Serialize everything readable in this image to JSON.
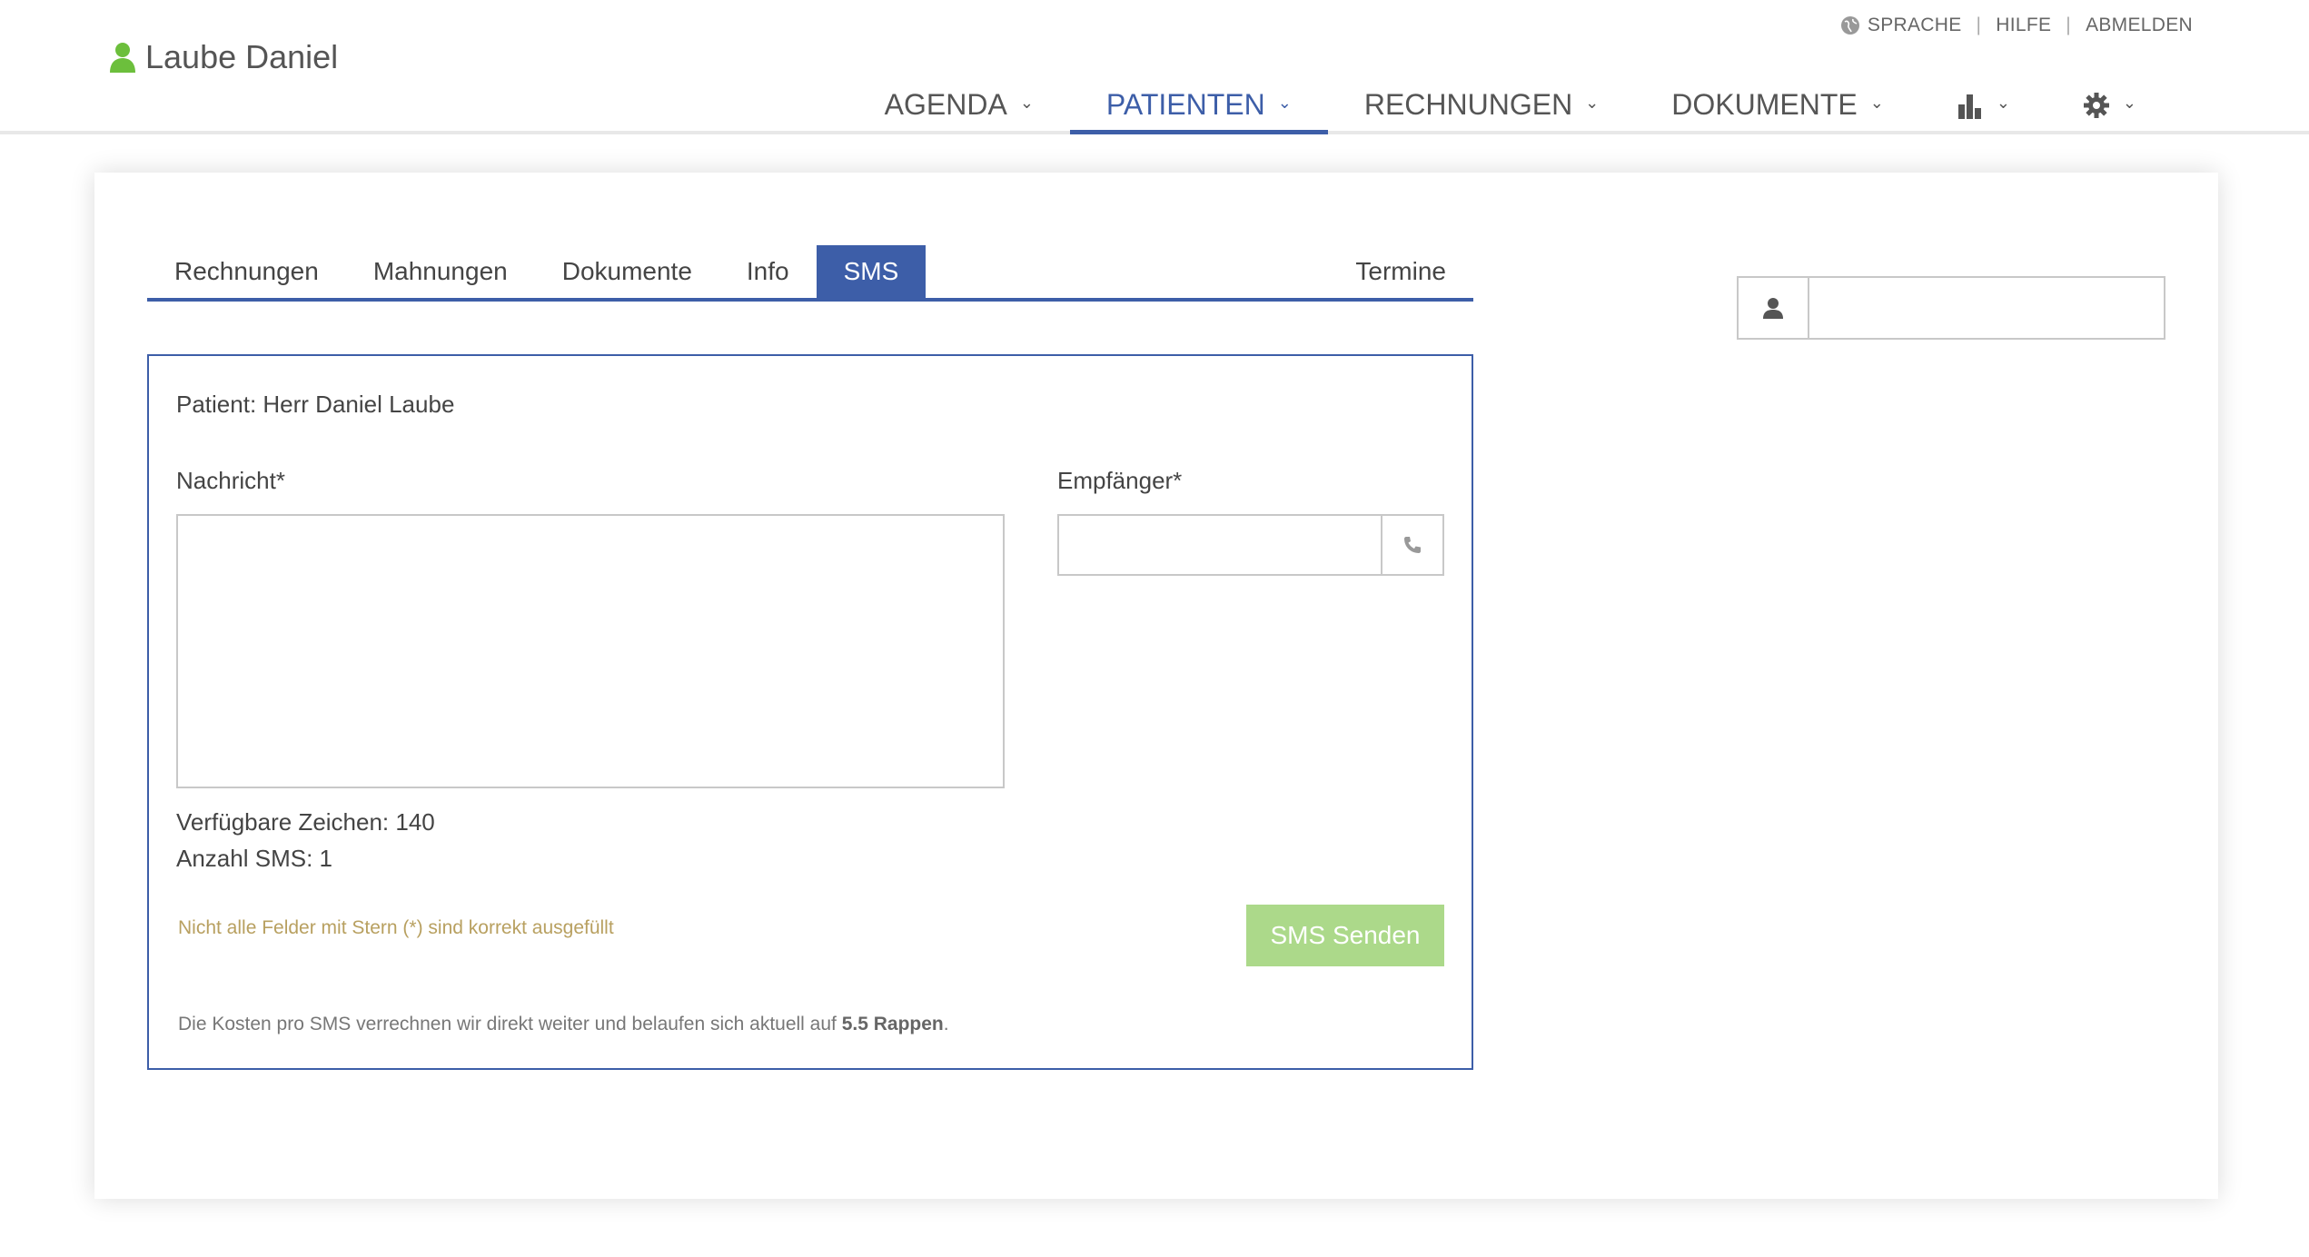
{
  "header": {
    "user_name": "Laube Daniel",
    "top_links": {
      "language": "SPRACHE",
      "help": "HILFE",
      "logout": "ABMELDEN"
    },
    "nav": [
      {
        "label": "AGENDA",
        "active": false
      },
      {
        "label": "PATIENTEN",
        "active": true
      },
      {
        "label": "RECHNUNGEN",
        "active": false
      },
      {
        "label": "DOKUMENTE",
        "active": false
      }
    ],
    "nav_icons": [
      "bar-chart-icon",
      "gear-icon"
    ],
    "chevron": "⌄"
  },
  "tabs": [
    {
      "label": "Rechnungen",
      "active": false
    },
    {
      "label": "Mahnungen",
      "active": false
    },
    {
      "label": "Dokumente",
      "active": false
    },
    {
      "label": "Info",
      "active": false
    },
    {
      "label": "SMS",
      "active": true
    },
    {
      "label": "Termine",
      "active": false
    }
  ],
  "sms_form": {
    "patient_line": "Patient: Herr Daniel Laube",
    "message_label": "Nachricht*",
    "message_value": "",
    "recipient_label": "Empfänger*",
    "recipient_value": "",
    "available_chars": "Verfügbare Zeichen: 140",
    "sms_count": "Anzahl SMS: 1",
    "warning": "Nicht alle Felder mit Stern (*) sind korrekt ausgefüllt",
    "send_label": "SMS Senden",
    "footnote_prefix": "Die Kosten pro SMS verrechnen wir direkt weiter und belaufen sich aktuell auf ",
    "footnote_amount": "5.5 Rappen",
    "footnote_suffix": "."
  },
  "search": {
    "value": ""
  },
  "colors": {
    "primary": "#3d5ea8",
    "user_icon": "#6cbf3c",
    "send_button": "#acd98a",
    "warning_text": "#b8a060"
  }
}
